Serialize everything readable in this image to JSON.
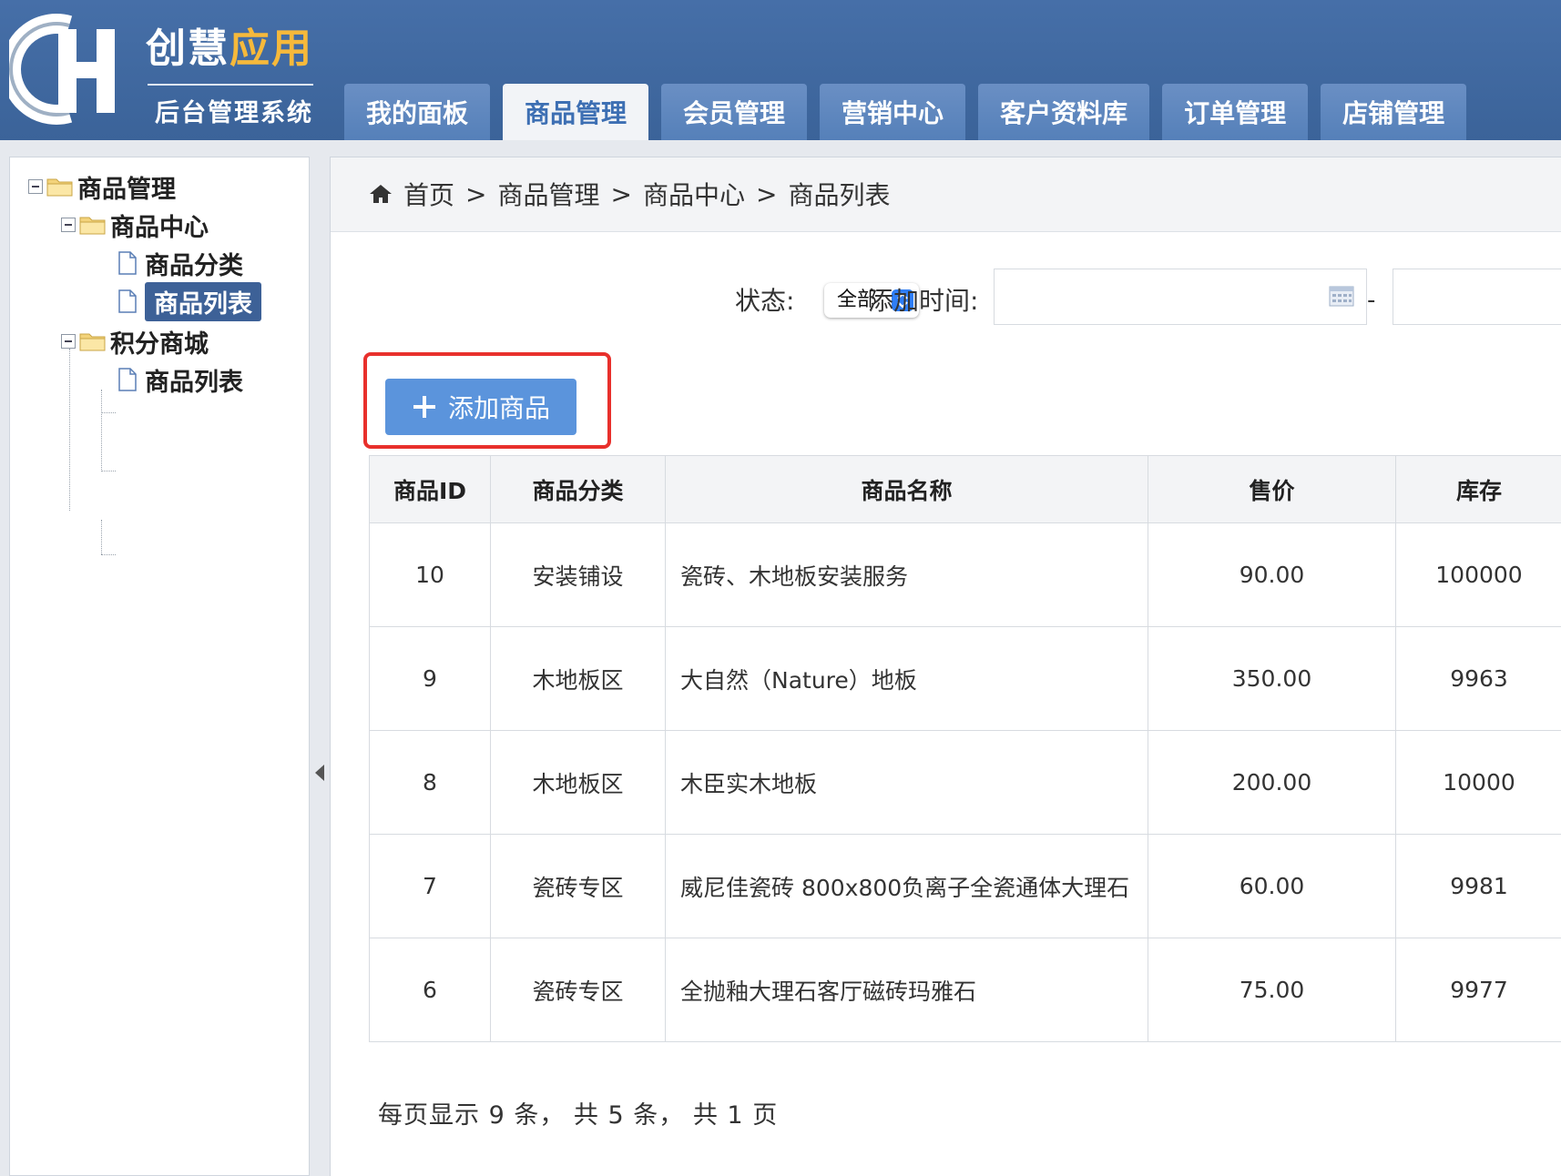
{
  "brand": {
    "logo_letters": "CH",
    "title_part1": "创慧",
    "title_part2": "应用",
    "subtitle": "后台管理系统",
    "title_accent_color": "#f6b93b"
  },
  "nav_tabs": [
    "我的面板",
    "商品管理",
    "会员管理",
    "营销中心",
    "客户资料库",
    "订单管理",
    "店铺管理"
  ],
  "active_tab": "商品管理",
  "sidebar": {
    "root": "商品管理",
    "groups": [
      {
        "label": "商品中心",
        "items": [
          "商品分类",
          "商品列表"
        ]
      },
      {
        "label": "积分商城",
        "items": [
          "商品列表"
        ]
      }
    ],
    "selected": "商品中心 > 商品列表",
    "selected_color": "#3d6197"
  },
  "breadcrumb": {
    "icon": "home-icon",
    "items": [
      "首页",
      "商品管理",
      "商品中心",
      "商品列表"
    ],
    "separator": ">"
  },
  "filter": {
    "status_label": "状态:",
    "status_value": "全部",
    "date_label": "添加时间:",
    "date_separator": "-"
  },
  "add_button": {
    "label": "添加商品",
    "icon": "plus-icon",
    "color": "#5b94dc",
    "highlight_color": "#e8302c"
  },
  "table": {
    "headers": [
      "商品ID",
      "商品分类",
      "商品名称",
      "售价",
      "库存"
    ],
    "rows": [
      [
        "10",
        "安装铺设",
        "瓷砖、木地板安装服务",
        "90.00",
        "100000"
      ],
      [
        "9",
        "木地板区",
        "大自然（Nature）地板",
        "350.00",
        "9963"
      ],
      [
        "8",
        "木地板区",
        "木臣实木地板",
        "200.00",
        "10000"
      ],
      [
        "7",
        "瓷砖专区",
        "威尼佳瓷砖 800x800负离子全瓷通体大理石",
        "60.00",
        "9981"
      ],
      [
        "6",
        "瓷砖专区",
        "全抛釉大理石客厅磁砖玛雅石",
        "75.00",
        "9977"
      ]
    ]
  },
  "pagination": {
    "text": "每页显示 9 条， 共 5 条， 共 1 页"
  }
}
